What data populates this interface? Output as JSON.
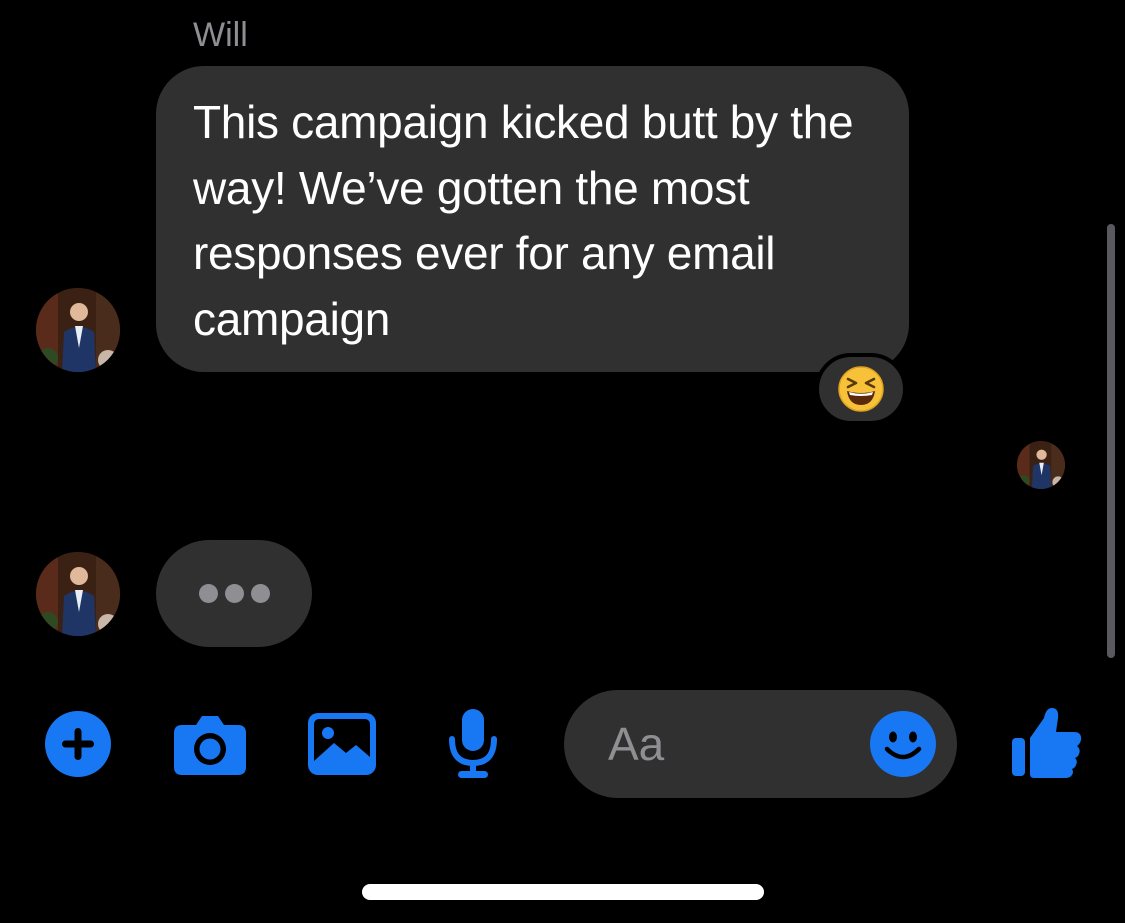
{
  "thread": {
    "sender_name": "Will",
    "message_text": "This campaign kicked butt by the way! We’ve gotten the most responses ever for any email campaign",
    "reaction_emoji": "laughing-squint-emoji",
    "typing_indicator": "typing-dots"
  },
  "composer": {
    "placeholder": "Aa",
    "value": ""
  },
  "toolbar": {
    "icons": [
      "plus-icon",
      "camera-icon",
      "photo-icon",
      "microphone-icon",
      "smiley-icon",
      "thumbs-up-icon"
    ]
  },
  "colors": {
    "accent": "#1877f2",
    "bubble": "#303030",
    "background": "#000000",
    "secondary_text": "#8e8e93"
  }
}
